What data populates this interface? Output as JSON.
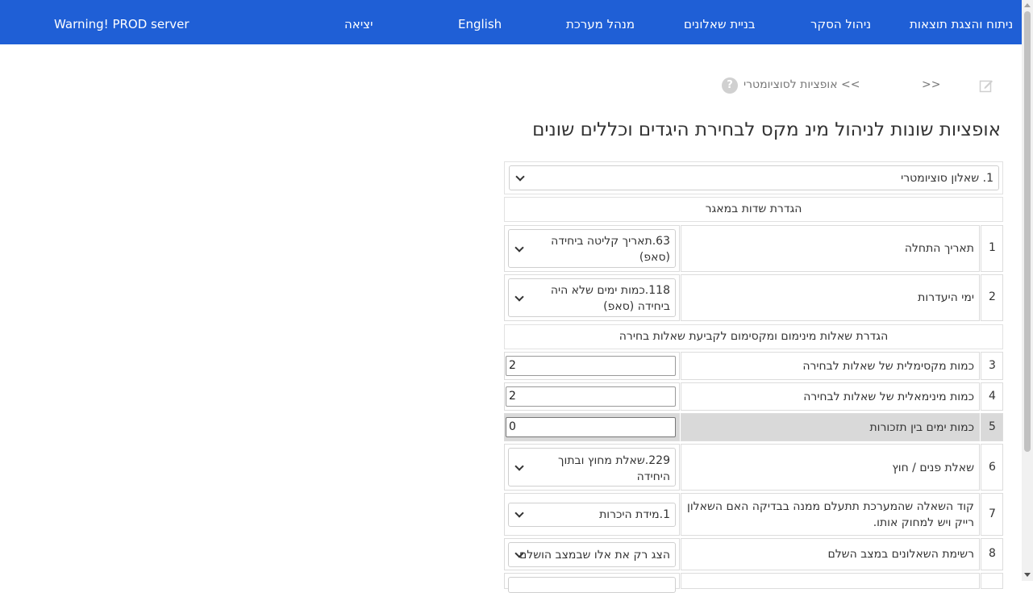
{
  "nav": {
    "analysis": "ניתוח והצגת תוצאות",
    "survey_management": "ניהול הסקר",
    "build_questionnaires": "בניית שאלונים",
    "admin": "מנהל מערכת",
    "english": "English",
    "logout": "יציאה",
    "warning": "Warning! PROD server"
  },
  "breadcrumb": {
    "prefix": ">>",
    "current": ">> אופציות לסוציומטרי"
  },
  "page_title": "אופציות שונות לניהול מינ מקס לבחירת היגדים וכללים שונים",
  "questionnaire_select": "1. שאלון סוציומטרי",
  "sections": {
    "db_fields": "הגדרת שדות במאגר",
    "min_max": "הגדרת שאלות מינימום ומקסימום לקביעת שאלות בחירה"
  },
  "rows": [
    {
      "num": "1",
      "label": "תאריך התחלה",
      "value_line1": "63.תאריך קליטה ביחידה",
      "value_line2": "(סאפ)"
    },
    {
      "num": "2",
      "label": "ימי היעדרות",
      "value_line1": "118.כמות ימים שלא היה",
      "value_line2": "ביחידה (סאפ)"
    },
    {
      "num": "3",
      "label": "כמות מקסימלית של שאלות לבחירה",
      "value": "2"
    },
    {
      "num": "4",
      "label": "כמות מינימאלית של שאלות לבחירה",
      "value": "2"
    },
    {
      "num": "5",
      "label": "כמות ימים בין תזכורות",
      "value": "0"
    },
    {
      "num": "6",
      "label": "שאלת פנים / חוץ",
      "value_line1": "229.שאלת מחוץ ובתוך",
      "value_line2": "היחידה"
    },
    {
      "num": "7",
      "label_line1": "קוד השאלה שהמערכת תתעלם ממנה בבדיקה האם השאלון",
      "label_line2": "רייק ויש למחוק אותו.",
      "value": "1.מידת היכרות"
    },
    {
      "num": "8",
      "label": "רשימת השאלונים במצב השלם",
      "value": "הצג רק את אלו שבמצב הושלם"
    }
  ]
}
